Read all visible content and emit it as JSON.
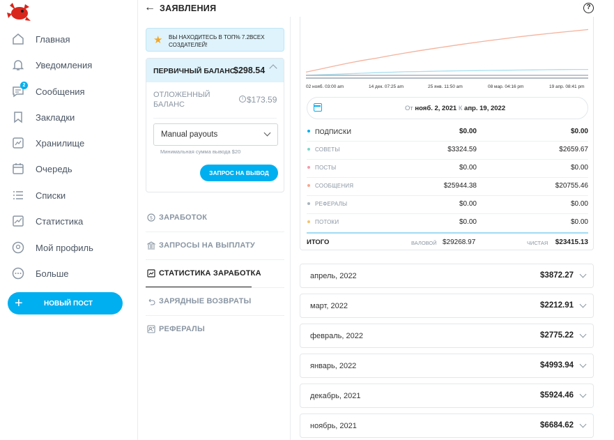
{
  "header": {
    "title": "ЗАЯВЛЕНИЯ"
  },
  "sidebar": {
    "items": [
      {
        "label": "Главная",
        "icon": "home-icon"
      },
      {
        "label": "Уведомления",
        "icon": "bell-icon"
      },
      {
        "label": "Сообщения",
        "icon": "message-icon",
        "badge": "2"
      },
      {
        "label": "Закладки",
        "icon": "bookmark-icon"
      },
      {
        "label": "Хранилище",
        "icon": "vault-icon"
      },
      {
        "label": "Очередь",
        "icon": "calendar-icon"
      },
      {
        "label": "Списки",
        "icon": "list-icon"
      },
      {
        "label": "Статистика",
        "icon": "stats-icon"
      },
      {
        "label": "Мой профиль",
        "icon": "profile-icon"
      },
      {
        "label": "Больше",
        "icon": "more-icon"
      }
    ],
    "new_post": "НОВЫЙ ПОСТ"
  },
  "top5": {
    "text": "ВЫ НАХОДИТЕСЬ В ТОП% 7.2ВСЕХ СОЗДАТЕЛЕЙ!"
  },
  "balance": {
    "primary_label": "ПЕРВИЧНЫЙ БАЛАНС",
    "primary_value": "$298.54",
    "pending_label": "ОТЛОЖЕННЫЙ БАЛАНС",
    "pending_value": "$173.59",
    "payout_select": "Manual payouts",
    "min_note": "Минимальная сумма вывода $20",
    "withdraw_button": "ЗАПРОС НА ВЫВОД"
  },
  "menu": [
    {
      "label": "ЗАРАБОТОК",
      "icon": "dollar-circle-icon",
      "active": false
    },
    {
      "label": "ЗАПРОСЫ НА ВЫПЛАТУ",
      "icon": "bank-icon",
      "active": false
    },
    {
      "label": "СТАТИСТИКА ЗАРАБОТКА",
      "icon": "chart-icon",
      "active": true
    },
    {
      "label": "ЗАРЯДНЫЕ ВОЗВРАТЫ",
      "icon": "undo-icon",
      "active": false
    },
    {
      "label": "РЕФЕРАЛЫ",
      "icon": "referral-icon",
      "active": false
    }
  ],
  "chart_data": {
    "type": "line",
    "x_ticks": [
      "02 нояб. 03:00 am",
      "14 дек. 07:25 am",
      "25 янв. 11:50 am",
      "08 мар. 04:16 pm",
      "19 апр. 08:41 pm"
    ],
    "series": [
      {
        "color": "#f4b19b",
        "values": [
          1800,
          3500,
          5200,
          6900,
          8400,
          9700,
          11200,
          12600,
          13900,
          15100,
          16300,
          17500,
          18600,
          19700,
          20700,
          21700,
          22600,
          23500,
          24300,
          25100,
          25900
        ]
      },
      {
        "color": "#a6dff0",
        "values": [
          0,
          300,
          600,
          900,
          1200,
          1500,
          1750,
          2000,
          2150,
          2300,
          2450,
          2550,
          2650,
          2750,
          2850,
          2950,
          3050,
          3150,
          3250,
          3300,
          3320
        ]
      },
      {
        "color": "#a8b4bf",
        "values": [
          0,
          0,
          0,
          0,
          0,
          0,
          0,
          0,
          0,
          0,
          0,
          0,
          0,
          0,
          0,
          0,
          0,
          0,
          0,
          0,
          0
        ]
      }
    ],
    "ylim": [
      0,
      30000
    ],
    "grid": false
  },
  "date_range": {
    "from_label": "От",
    "from": "нояб. 2, 2021",
    "to_label": "К",
    "to": "апр. 19, 2022"
  },
  "stats": [
    {
      "label": "ПОДПИСКИ",
      "dot": "#00aff0",
      "gross": "$0.00",
      "net": "$0.00",
      "dark": true,
      "bold": true
    },
    {
      "label": "СОВЕТЫ",
      "dot": "#7ed6c8",
      "gross": "$3324.59",
      "net": "$2659.67",
      "dark": false,
      "bold": false
    },
    {
      "label": "ПОСТЫ",
      "dot": "#f39bab",
      "gross": "$0.00",
      "net": "$0.00",
      "dark": false,
      "bold": false
    },
    {
      "label": "СООБЩЕНИЯ",
      "dot": "#f7a78e",
      "gross": "$25944.38",
      "net": "$20755.46",
      "dark": false,
      "bold": false
    },
    {
      "label": "РЕФЕРАЛЫ",
      "dot": "#a8b4bf",
      "gross": "$0.00",
      "net": "$0.00",
      "dark": false,
      "bold": false
    },
    {
      "label": "ПОТОКИ",
      "dot": "#f5c36b",
      "gross": "$0.00",
      "net": "$0.00",
      "dark": false,
      "bold": false
    }
  ],
  "total": {
    "label": "ИТОГО",
    "gross_label": "ВАЛОВОЙ",
    "gross": "$29268.97",
    "net_label": "ЧИСТАЯ",
    "net": "$23415.13"
  },
  "months": [
    {
      "month": "апрель, 2022",
      "amount": "$3872.27"
    },
    {
      "month": "март, 2022",
      "amount": "$2212.91"
    },
    {
      "month": "февраль, 2022",
      "amount": "$2775.22"
    },
    {
      "month": "январь, 2022",
      "amount": "$4993.94"
    },
    {
      "month": "декабрь, 2021",
      "amount": "$5924.46"
    },
    {
      "month": "ноябрь, 2021",
      "amount": "$6684.62"
    }
  ]
}
